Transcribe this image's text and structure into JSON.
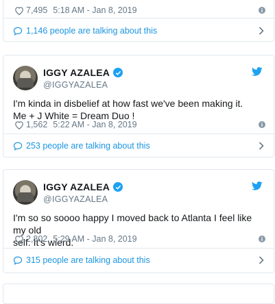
{
  "prev_tweet": {
    "likes": "7,495",
    "time": "5:18 AM - Jan 8, 2019",
    "talking": "1,146 people are talking about this"
  },
  "tweets": [
    {
      "name": "IGGY AZALEA",
      "handle": "@IGGYAZALEA",
      "text_line1": "I'm kinda in disbelief at how fast we've been making it.",
      "text_line2": "Me + J White = Dream Duo !",
      "likes": "1,562",
      "time": "5:22 AM - Jan 8, 2019",
      "talking": "253 people are talking about this"
    },
    {
      "name": "IGGY AZALEA",
      "handle": "@IGGYAZALEA",
      "text_line1": "I'm so so soooo happy I moved back to Atlanta I feel like my old",
      "text_line2": "self. It's wierd.",
      "likes": "2,802",
      "time": "5:29 AM - Jan 8, 2019",
      "talking": "315 people are talking about this"
    }
  ],
  "colors": {
    "link": "#1b95e0",
    "twitter_blue": "#1da1f2",
    "muted": "#657786",
    "border": "#e1e8ed"
  },
  "icons": [
    "heart-icon",
    "info-icon",
    "comment-bubble-icon",
    "chevron-right-icon",
    "twitter-bird-icon",
    "verified-badge-icon"
  ]
}
